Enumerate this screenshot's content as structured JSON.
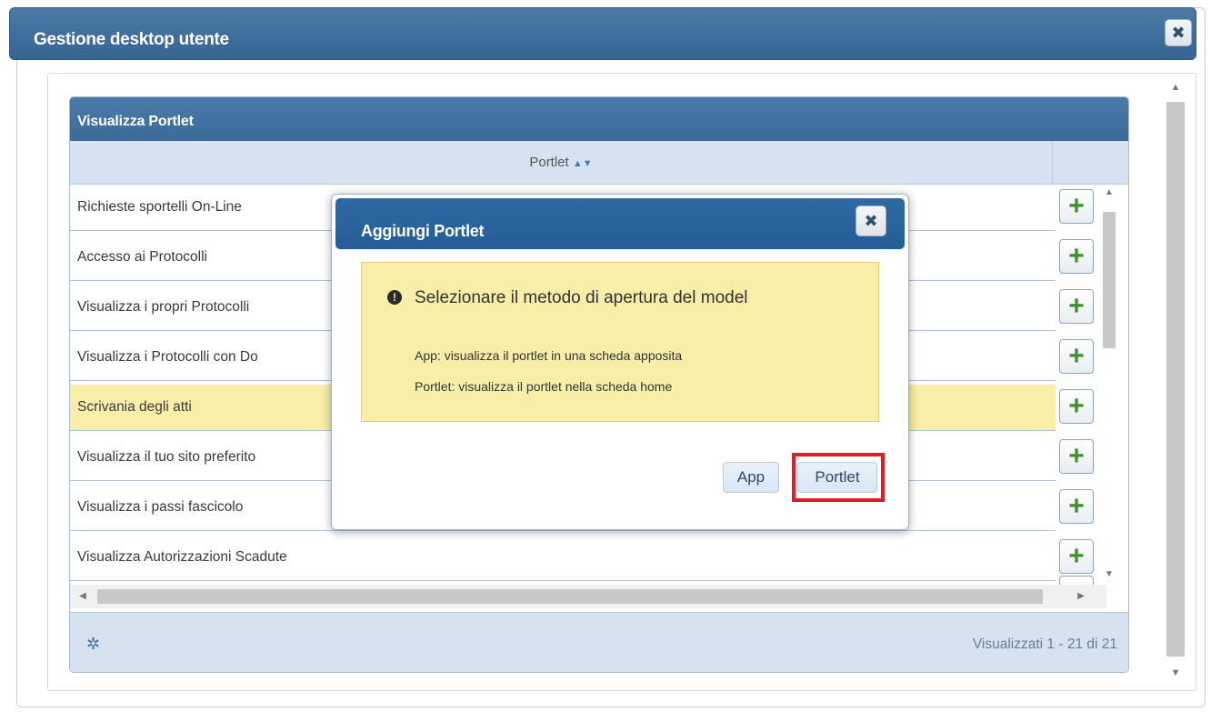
{
  "window": {
    "title": "Gestione desktop utente",
    "close_glyph": "✖"
  },
  "panel": {
    "title": "Visualizza Portlet",
    "column_header": "Portlet",
    "rows": [
      "Richieste sportelli On-Line",
      "Accesso ai Protocolli",
      "Visualizza i propri Protocolli",
      "Visualizza i Protocolli con Do",
      "Scrivania degli atti",
      "Visualizza il tuo sito preferito",
      "Visualizza i passi fascicolo",
      "Visualizza Autorizzazioni Scadute"
    ],
    "selected_row_index": 4,
    "add_glyph": "+",
    "footer_info": "Visualizzati 1 - 21 di 21"
  },
  "modal": {
    "title": "Aggiungi Portlet",
    "close_glyph": "✖",
    "message_title": "Selezionare il metodo di apertura del model",
    "line1": "App: visualizza il portlet in una scheda apposita",
    "line2": "Portlet: visualizza il portlet nella scheda home",
    "btn_app": "App",
    "btn_portlet": "Portlet"
  },
  "icons": {
    "sort": "sort-icon",
    "gear": "gear-icon",
    "warning": "exclamation-circle-icon",
    "add": "plus-icon",
    "close": "close-icon"
  },
  "colors": {
    "header_blue": "#3f6e9d",
    "modal_header_blue": "#2f6aa6",
    "highlight_row": "#f8eea8",
    "add_green": "#3f8f2a",
    "annotation_red": "#e31b23"
  }
}
